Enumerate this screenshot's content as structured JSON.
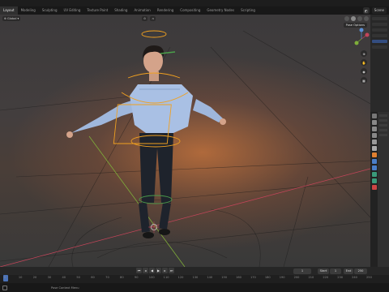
{
  "topbar": {
    "tabs": [
      "Layout",
      "Modeling",
      "Sculpting",
      "UV Editing",
      "Texture Paint",
      "Shading",
      "Animation",
      "Rendering",
      "Compositing",
      "Geometry Nodes",
      "Scripting"
    ],
    "active_tab": 0,
    "scene_label": "Scene"
  },
  "viewport": {
    "header": {
      "mode": "",
      "transform_orientation": "Global"
    },
    "pose_options": "Pose Options",
    "gizmo": {
      "x": "X",
      "y": "Y",
      "z": "Z"
    }
  },
  "timeline": {
    "current_frame": "1",
    "start_label": "Start",
    "start_value": "1",
    "end_label": "End",
    "end_value": "250"
  },
  "ruler": {
    "ticks": [
      "0",
      "10",
      "20",
      "30",
      "40",
      "50",
      "60",
      "70",
      "80",
      "90",
      "100",
      "110",
      "120",
      "130",
      "140",
      "150",
      "160",
      "170",
      "180",
      "190",
      "200",
      "210",
      "220",
      "230",
      "240",
      "250"
    ]
  },
  "statusbar": {
    "text": "Pose Context Menu"
  },
  "colors": {
    "accent": "#4a72b8",
    "bone_highlight": "#f0a020",
    "axis_x": "#c4455a",
    "axis_y": "#7fae3a"
  }
}
